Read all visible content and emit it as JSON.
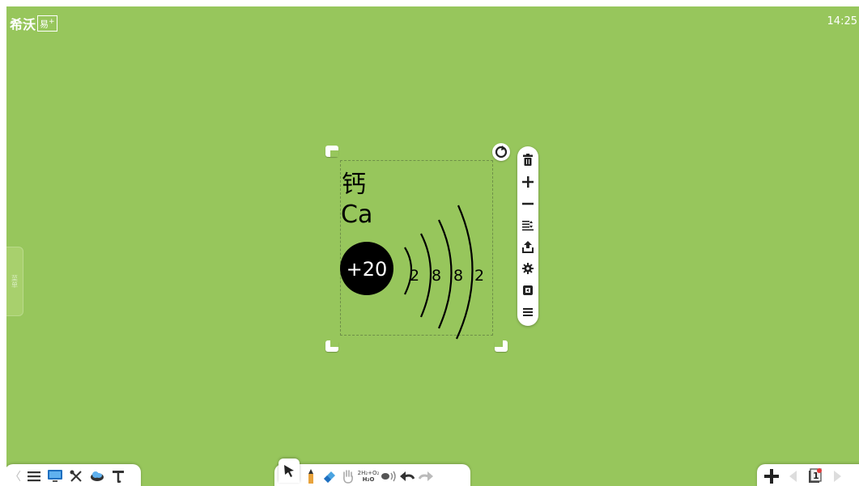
{
  "app": {
    "logo_text": "希沃",
    "logo_badge": "易",
    "logo_plus": "+",
    "clock": "14:25",
    "side_tab_label": "菜单"
  },
  "board": {
    "background": "#97c65c"
  },
  "atom": {
    "element_name": "钙",
    "element_symbol": "Ca",
    "nucleus": "+20",
    "shells": [
      "2",
      "8",
      "8",
      "2"
    ]
  },
  "object_toolbar": [
    {
      "name": "delete",
      "icon": "trash-icon"
    },
    {
      "name": "zoom-in",
      "icon": "plus-icon"
    },
    {
      "name": "zoom-out",
      "icon": "minus-icon"
    },
    {
      "name": "layer",
      "icon": "layer-order-icon"
    },
    {
      "name": "export",
      "icon": "upload-icon"
    },
    {
      "name": "settings",
      "icon": "gear-icon"
    },
    {
      "name": "clone",
      "icon": "copy-icon"
    },
    {
      "name": "more",
      "icon": "menu-icon"
    }
  ],
  "bottom_left": [
    "menu-icon",
    "display-icon",
    "tools-icon",
    "cloud-icon",
    "text-icon"
  ],
  "bottom_mid": [
    "pointer-icon",
    "pen-icon",
    "eraser-icon",
    "hand-icon",
    "chemistry-icon",
    "sound-icon",
    "undo-icon",
    "redo-icon"
  ],
  "chem_label_top": "2H₂+O₂",
  "chem_label_bottom": "H₂O",
  "bottom_right": {
    "page_number": "1",
    "icons": [
      "add-page-icon",
      "prev-page-icon",
      "page-counter-icon",
      "next-page-icon"
    ]
  }
}
